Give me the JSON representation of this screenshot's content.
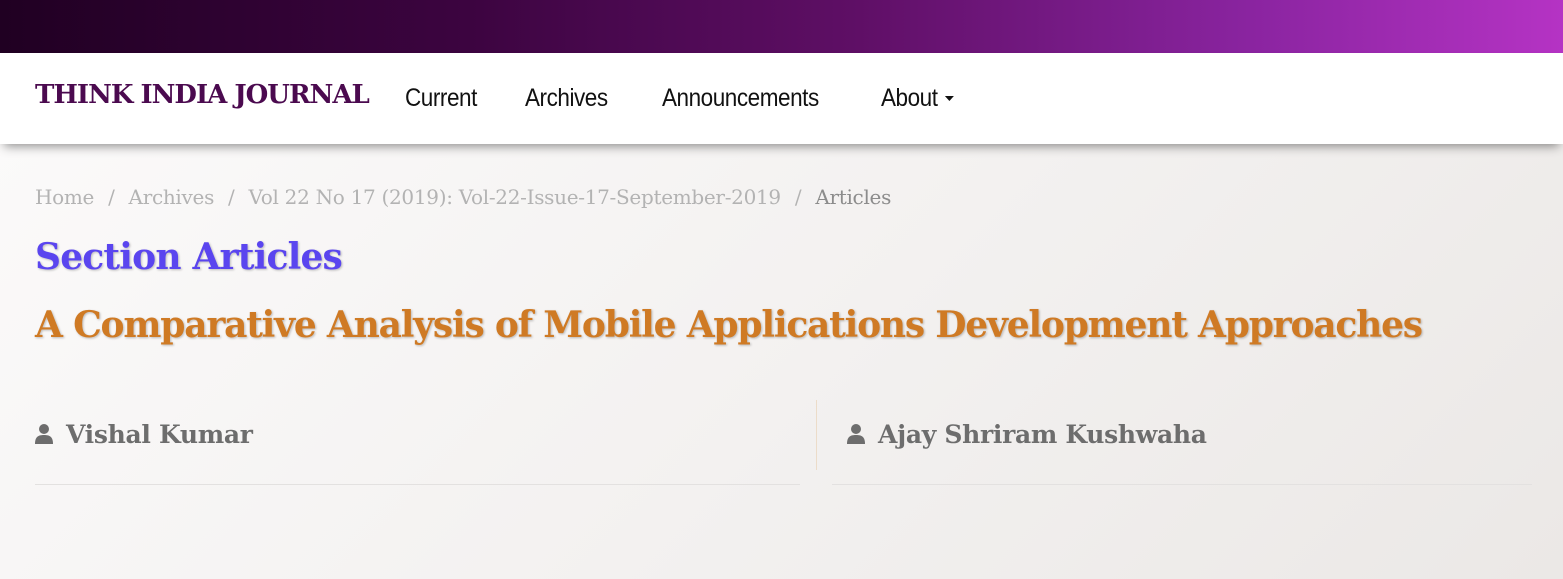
{
  "header": {
    "brand": "THINK INDIA JOURNAL",
    "nav": {
      "current": "Current",
      "archives": "Archives",
      "announcements": "Announcements",
      "about": "About"
    }
  },
  "breadcrumb": {
    "home": "Home",
    "archives": "Archives",
    "issue": "Vol 22 No 17 (2019): Vol-22-Issue-17-September-2019",
    "current": "Articles",
    "separator": "/"
  },
  "main": {
    "section_title": "Section Articles",
    "article_title": "A Comparative Analysis of Mobile Applications Development Approaches",
    "authors": [
      {
        "name": "Vishal Kumar",
        "icon": "user-icon"
      },
      {
        "name": "Ajay Shriram Kushwaha",
        "icon": "user-icon"
      }
    ]
  },
  "colors": {
    "brand": "#4b0a4f",
    "section_title": "#5a45ef",
    "article_title": "#cf7a24",
    "author_text": "#6d6d6d",
    "top_bar_start": "#200022",
    "top_bar_end": "#b533c4"
  }
}
